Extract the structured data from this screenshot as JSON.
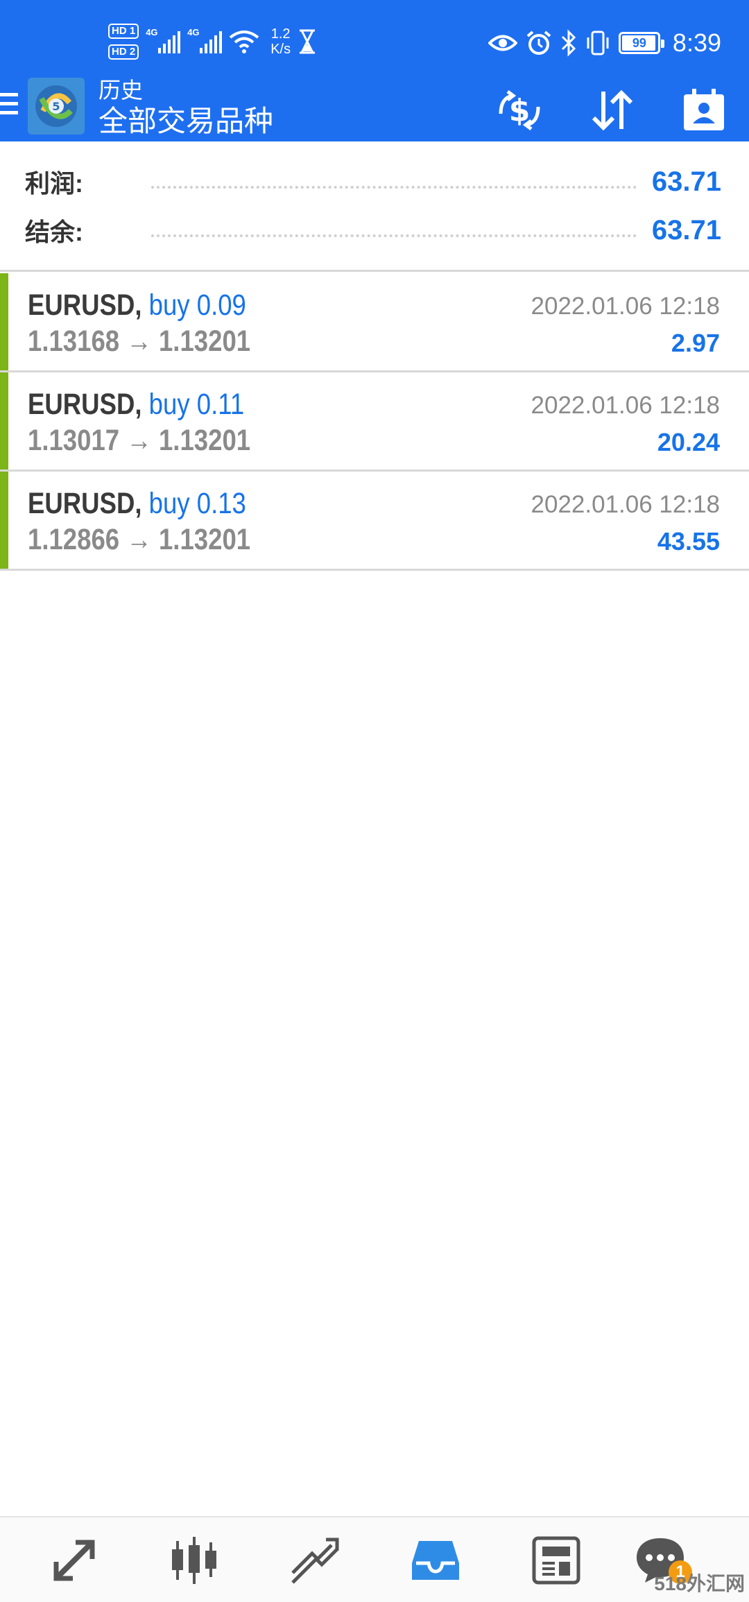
{
  "status_bar": {
    "sim1": "HD 1",
    "sim2": "HD 2",
    "net1": "4G",
    "net2": "4G",
    "speed_value": "1.2",
    "speed_unit": "K/s",
    "battery": "99",
    "time": "8:39"
  },
  "header": {
    "subtitle": "历史",
    "title": "全部交易品种",
    "icons": [
      "menu-icon",
      "metatrader-logo",
      "currency-exchange-icon",
      "sort-icon",
      "calendar-person-icon"
    ]
  },
  "summary": {
    "profit_label": "利润:",
    "profit_value": "63.71",
    "balance_label": "结余:",
    "balance_value": "63.71"
  },
  "deals": [
    {
      "symbol": "EURUSD,",
      "side": "buy 0.09",
      "prices": "1.13168 → 1.13201",
      "time": "2022.01.06 12:18",
      "profit": "2.97"
    },
    {
      "symbol": "EURUSD,",
      "side": "buy 0.11",
      "prices": "1.13017 → 1.13201",
      "time": "2022.01.06 12:18",
      "profit": "20.24"
    },
    {
      "symbol": "EURUSD,",
      "side": "buy 0.13",
      "prices": "1.12866 → 1.13201",
      "time": "2022.01.06 12:18",
      "profit": "43.55"
    }
  ],
  "colors": {
    "primary": "#1e6ff0",
    "value_blue": "#1773e8",
    "buy_accent": "#7cb518",
    "badge_orange": "#f39c12"
  },
  "bottom_nav": {
    "items": [
      "quotes-icon",
      "chart-icon",
      "trade-icon",
      "history-icon",
      "news-icon",
      "chat-icon"
    ],
    "active": "history-icon",
    "chat_badge": "1"
  },
  "watermark": "518外汇网"
}
